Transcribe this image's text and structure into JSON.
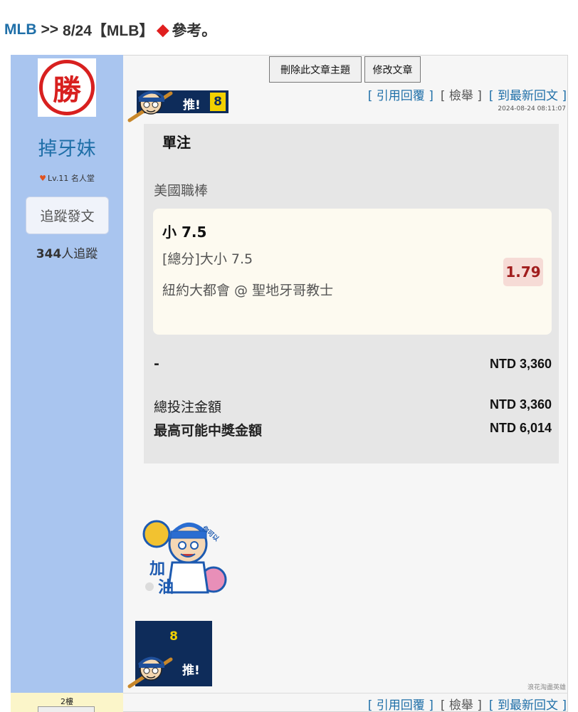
{
  "breadcrumb": {
    "forum": "MLB",
    "separator": ">>",
    "title": "8/24【MLB】",
    "diamond": "◆",
    "title_suffix": "參考。"
  },
  "author": {
    "avatar_text": "勝",
    "name": "掉牙妹",
    "level": "Lv.11 名人堂",
    "follow_label": "追蹤發文",
    "follower_count": "344",
    "follower_suffix": "人追蹤"
  },
  "toolbar": {
    "delete_label": "刪除此文章主題",
    "edit_label": "修改文章"
  },
  "push": {
    "label": "推!",
    "count": "8"
  },
  "post_links": {
    "quote": "[ 引用回覆 ]",
    "report": "[ 檢舉 ]",
    "latest": "[ 到最新回文 ]"
  },
  "timestamp": "2024-08-24 08:11:07",
  "bet": {
    "type": "單注",
    "league": "美國職棒",
    "pick": "小 7.5",
    "market": "[總分]大小 7.5",
    "match": "紐約大都會 @ 聖地牙哥教士",
    "odds": "1.79",
    "stake_label": "-",
    "stake_value": "NTD 3,360",
    "total_label": "總投注金額",
    "total_value": "NTD 3,360",
    "max_label": "最高可能中獎金額",
    "max_value": "NTD 6,014"
  },
  "sticker": {
    "text1": "加",
    "text2": "油",
    "text3": "你可以"
  },
  "signature": "浪花淘盡英雄",
  "reply": {
    "floor": "2樓",
    "quote": "[ 引用回覆 ]",
    "report": "[ 檢舉 ]",
    "latest": "[ 到最新回文 ]"
  },
  "colors": {
    "link": "#1f6fa8",
    "sidebar": "#a9c5ef",
    "push_navy": "#0e2c5a",
    "push_yellow": "#f3d100",
    "odds_red": "#a11d1d"
  }
}
